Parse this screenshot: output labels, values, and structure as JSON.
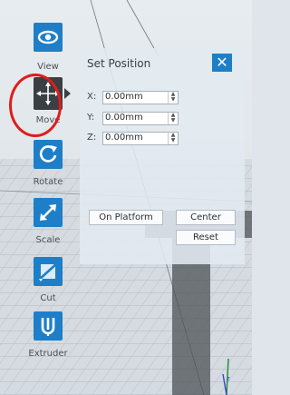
{
  "toolbar": {
    "items": [
      {
        "label": "View",
        "icon": "eye-icon"
      },
      {
        "label": "Move",
        "icon": "move-arrows-icon"
      },
      {
        "label": "Rotate",
        "icon": "rotate-icon"
      },
      {
        "label": "Scale",
        "icon": "scale-arrow-icon"
      },
      {
        "label": "Cut",
        "icon": "cut-icon"
      },
      {
        "label": "Extruder",
        "icon": "extruder-icon"
      }
    ],
    "active": "Move"
  },
  "panel": {
    "title": "Set Position",
    "close_label": "✕",
    "fields": [
      {
        "axis": "X:",
        "value": "0.00mm"
      },
      {
        "axis": "Y:",
        "value": "0.00mm"
      },
      {
        "axis": "Z:",
        "value": "0.00mm"
      }
    ],
    "on_platform_label": "On Platform",
    "center_label": "Center",
    "reset_label": "Reset"
  },
  "colors": {
    "accent": "#1e7fc8",
    "active_tool": "#3a3f44",
    "highlight_circle": "#e21b1b"
  }
}
